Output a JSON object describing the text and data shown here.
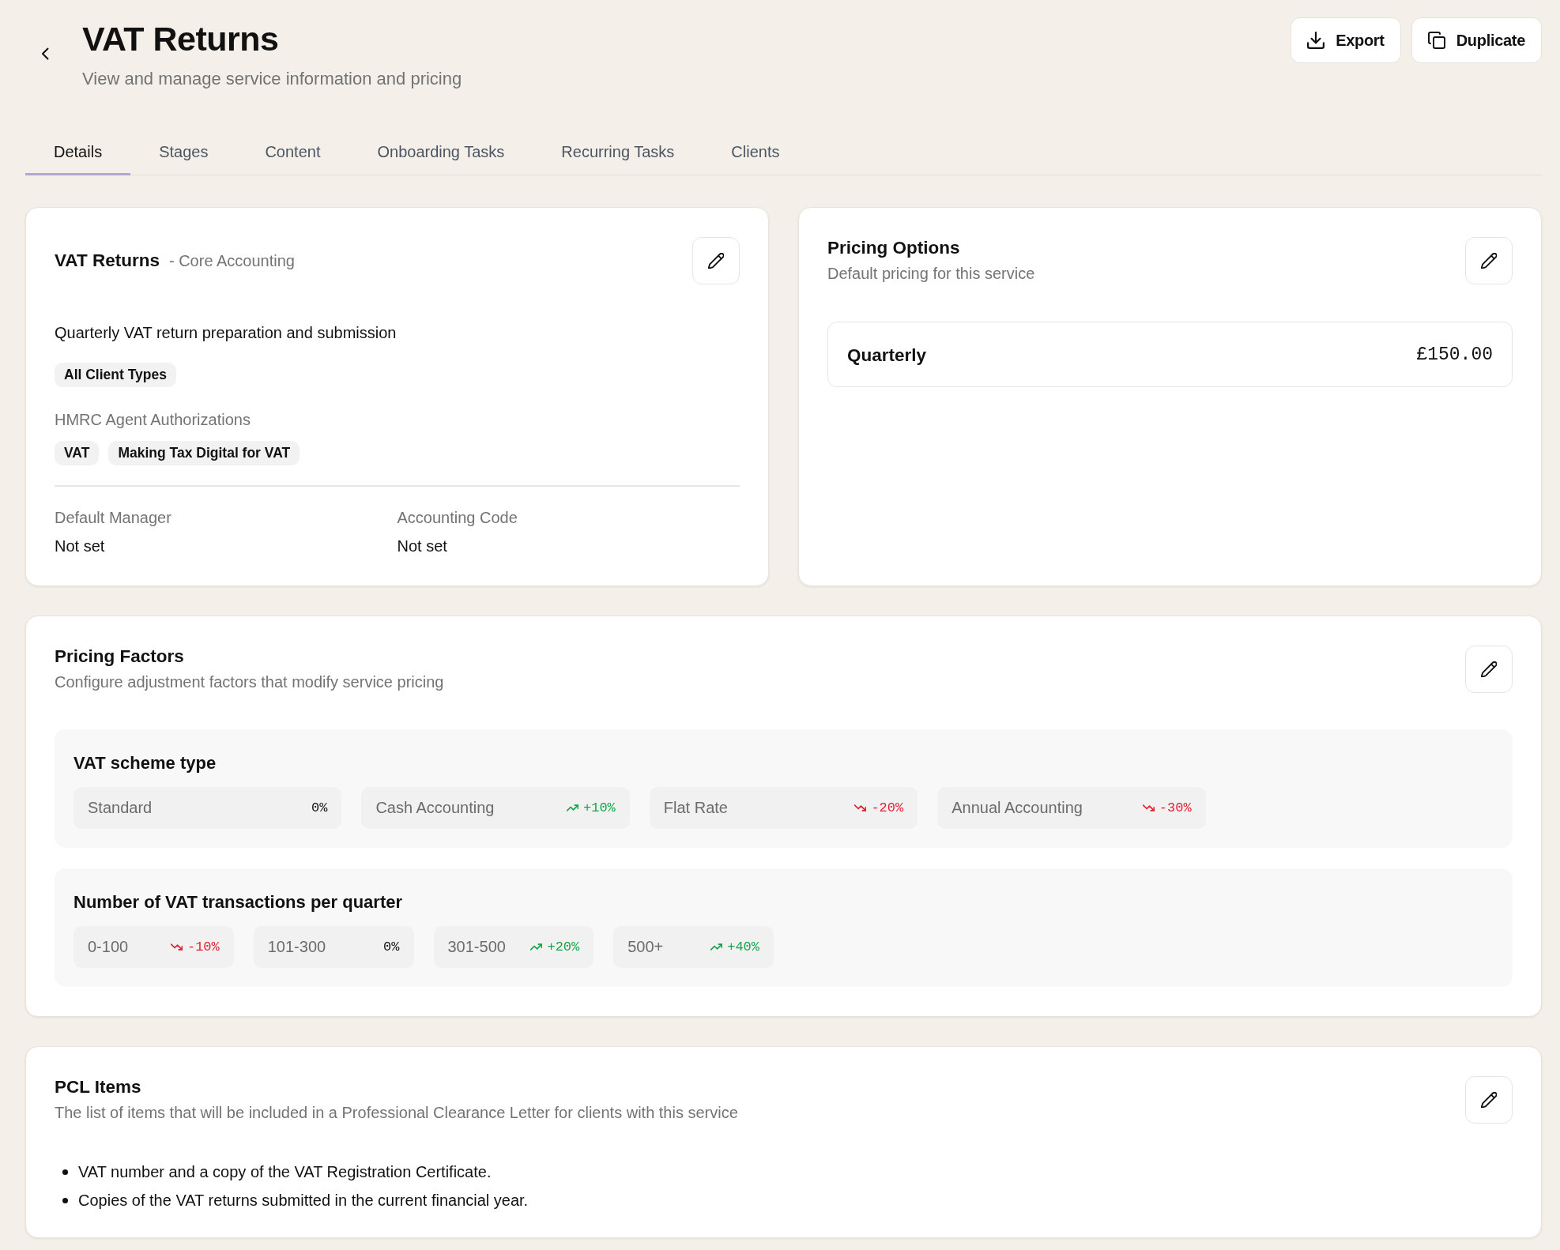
{
  "page": {
    "title": "VAT Returns",
    "subtitle": "View and manage service information and pricing"
  },
  "actions": [
    {
      "kind": "export",
      "label": "Export"
    },
    {
      "kind": "duplicate",
      "label": "Duplicate"
    }
  ],
  "tabs": [
    {
      "label": "Details",
      "selected": true
    },
    {
      "label": "Stages",
      "selected": false
    },
    {
      "label": "Content",
      "selected": false
    },
    {
      "label": "Onboarding Tasks",
      "selected": false
    },
    {
      "label": "Recurring Tasks",
      "selected": false
    },
    {
      "label": "Clients",
      "selected": false
    }
  ],
  "service_card": {
    "name": "VAT Returns",
    "category": "- Core Accounting",
    "description": "Quarterly VAT return preparation and submission",
    "client_types": [
      "All Client Types"
    ],
    "authorizations_label": "HMRC Agent Authorizations",
    "authorizations": [
      "VAT",
      "Making Tax Digital for VAT"
    ],
    "fields": [
      {
        "label": "Default Manager",
        "value": "Not set"
      },
      {
        "label": "Accounting Code",
        "value": "Not set"
      }
    ]
  },
  "pricing_options": {
    "title": "Pricing Options",
    "subtitle": "Default pricing for this service",
    "options": [
      {
        "name": "Quarterly",
        "price": "£150.00"
      }
    ]
  },
  "pricing_factors": {
    "title": "Pricing Factors",
    "subtitle": "Configure adjustment factors that modify service pricing",
    "factors": [
      {
        "name": "VAT scheme type",
        "options": [
          {
            "label": "Standard",
            "adjustment": "0%",
            "kind": "neutral"
          },
          {
            "label": "Cash Accounting",
            "adjustment": "+10%",
            "kind": "increase"
          },
          {
            "label": "Flat Rate",
            "adjustment": "-20%",
            "kind": "decrease"
          },
          {
            "label": "Annual Accounting",
            "adjustment": "-30%",
            "kind": "decrease"
          }
        ]
      },
      {
        "name": "Number of VAT transactions per quarter",
        "options": [
          {
            "label": "0-100",
            "adjustment": "-10%",
            "kind": "decrease"
          },
          {
            "label": "101-300",
            "adjustment": "0%",
            "kind": "neutral"
          },
          {
            "label": "301-500",
            "adjustment": "+20%",
            "kind": "increase"
          },
          {
            "label": "500+",
            "adjustment": "+40%",
            "kind": "increase"
          }
        ]
      }
    ]
  },
  "pcl_items": {
    "title": "PCL Items",
    "subtitle": "The list of items that will be included in a Professional Clearance Letter for clients with this service",
    "items": [
      "VAT number and a copy of the VAT Registration Certificate.",
      "Copies of the VAT returns submitted in the current financial year."
    ]
  }
}
